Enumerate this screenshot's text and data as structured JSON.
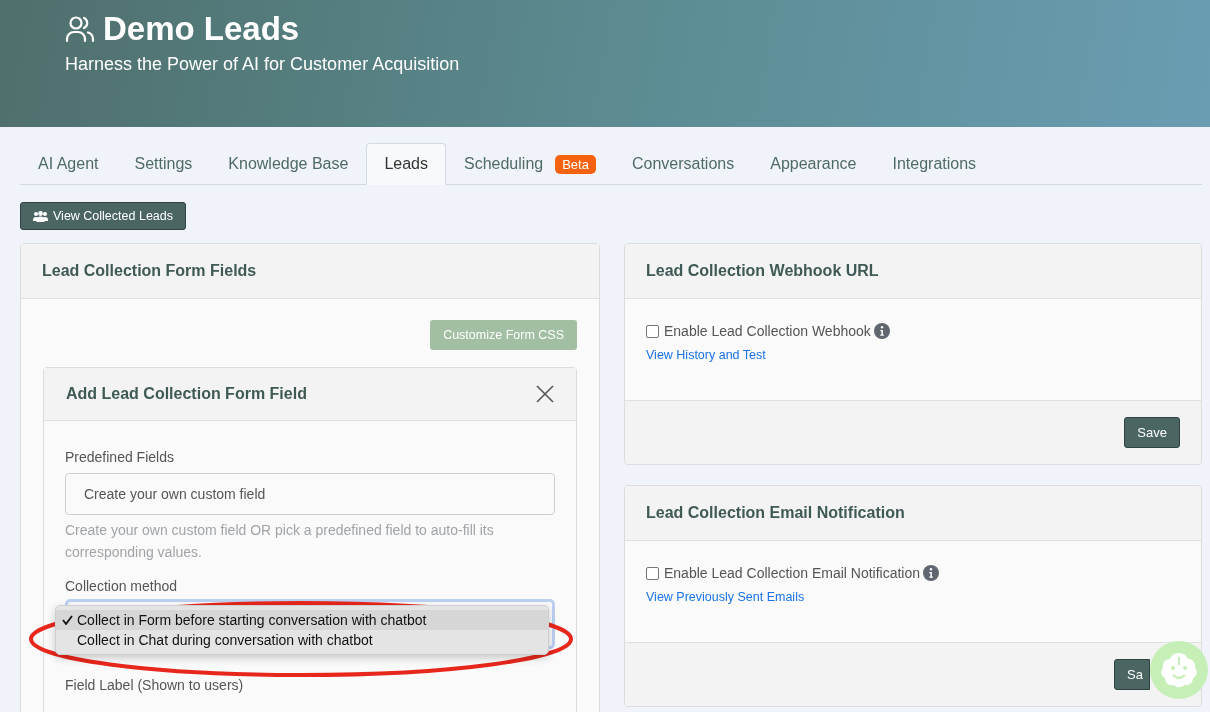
{
  "header": {
    "title": "Demo Leads",
    "subtitle": "Harness the Power of AI for Customer Acquisition"
  },
  "tabs": [
    {
      "label": "AI Agent",
      "selected": false
    },
    {
      "label": "Settings",
      "selected": false
    },
    {
      "label": "Knowledge Base",
      "selected": false
    },
    {
      "label": "Leads",
      "selected": true
    },
    {
      "label": "Scheduling",
      "selected": false,
      "badge": "Beta"
    },
    {
      "label": "Conversations",
      "selected": false
    },
    {
      "label": "Appearance",
      "selected": false
    },
    {
      "label": "Integrations",
      "selected": false
    }
  ],
  "view_leads_button": "View Collected Leads",
  "form_fields_panel": {
    "title": "Lead Collection Form Fields",
    "customize_button": {
      "label": "Customize Form CSS",
      "disabled": true
    },
    "add_field_card": {
      "title": "Add Lead Collection Form Field",
      "predefined_label": "Predefined Fields",
      "predefined_value": "Create your own custom field",
      "help_text": "Create your own custom field OR pick a predefined field to auto-fill its corresponding values.",
      "collection_method_label": "Collection method",
      "collection_options": [
        {
          "label": "Collect in Form before starting conversation with chatbot",
          "selected": true
        },
        {
          "label": "Collect in Chat during conversation with chatbot",
          "selected": false
        }
      ],
      "field_label": "Field Label (Shown to users)"
    }
  },
  "webhook_panel": {
    "title": "Lead Collection Webhook URL",
    "checkbox_label": "Enable Lead Collection Webhook",
    "checked": false,
    "link": "View History and Test",
    "save_button": "Save"
  },
  "email_panel": {
    "title": "Lead Collection Email Notification",
    "checkbox_label": "Enable Lead Collection Email Notification",
    "checked": false,
    "link": "View Previously Sent Emails",
    "save_button": "Sa"
  }
}
